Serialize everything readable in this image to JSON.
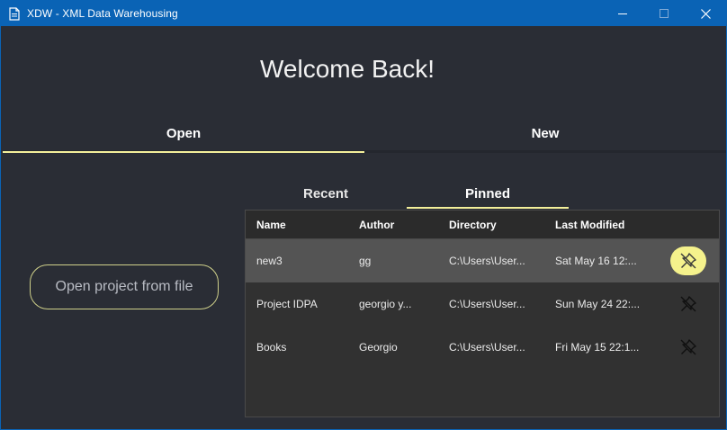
{
  "window": {
    "title": "XDW - XML Data Warehousing",
    "controls": [
      "minimize",
      "maximize",
      "close"
    ]
  },
  "heading": "Welcome Back!",
  "main_tabs": [
    {
      "label": "Open",
      "active": true
    },
    {
      "label": "New",
      "active": false
    }
  ],
  "open_file_button": "Open project from file",
  "sub_tabs": [
    {
      "label": "Recent",
      "active": false
    },
    {
      "label": "Pinned",
      "active": true
    }
  ],
  "table": {
    "columns": [
      "Name",
      "Author",
      "Directory",
      "Last Modified"
    ],
    "rows": [
      {
        "name": "new3",
        "author": "gg",
        "directory": "C:\\Users\\User...",
        "modified": "Sat May 16 12:...",
        "selected": true
      },
      {
        "name": "Project IDPA",
        "author": "georgio y...",
        "directory": "C:\\Users\\User...",
        "modified": "Sun May 24 22:...",
        "selected": false
      },
      {
        "name": "Books",
        "author": "Georgio",
        "directory": "C:\\Users\\User...",
        "modified": "Fri May 15 22:1...",
        "selected": false
      }
    ]
  },
  "colors": {
    "titlebar": "#0a63b5",
    "background": "#2a2d35",
    "accent": "#f3ef9a",
    "pin_highlight": "#f5f28c"
  }
}
